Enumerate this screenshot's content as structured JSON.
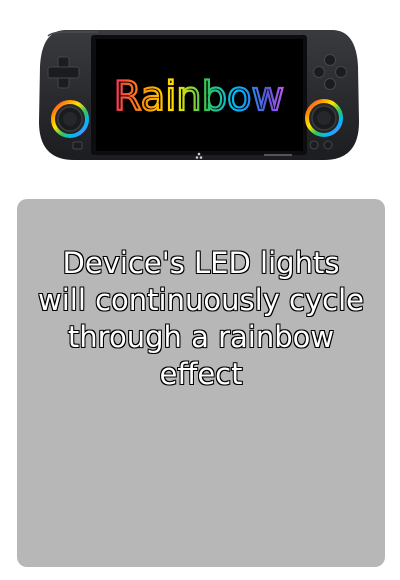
{
  "device": {
    "screen_text": "Rainbow",
    "led_effect": "rainbow",
    "body_color": "#2a2b2e",
    "screen_color": "#000000"
  },
  "description": {
    "text": "Device's LED lights will continuously cycle through a rainbow effect"
  },
  "colors": {
    "card_background": "#b7b7b7",
    "text_fill": "#ffffff",
    "text_outline": "#111111"
  }
}
